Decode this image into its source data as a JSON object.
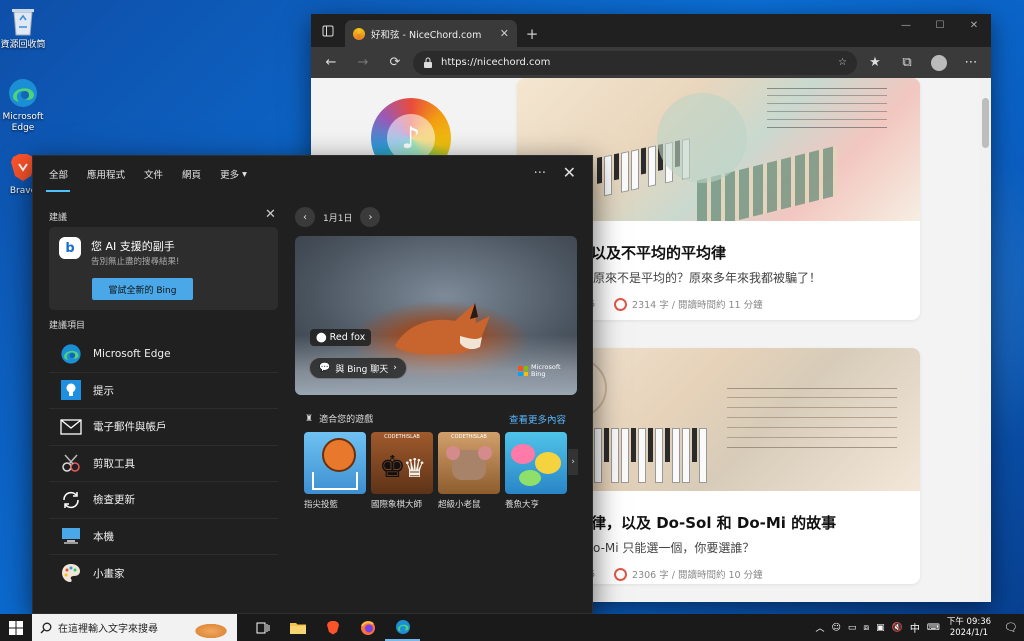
{
  "desktop": {
    "icons": [
      {
        "label": "資源回收筒",
        "icon": "recycle-bin-icon"
      },
      {
        "label": "Microsoft Edge",
        "icon": "edge-icon"
      },
      {
        "label": "Brave",
        "icon": "brave-icon"
      }
    ]
  },
  "browser": {
    "tab_title": "好和弦 - NiceChord.com",
    "url": "https://nicechord.com",
    "cards": [
      {
        "title": "以及不平均的平均律",
        "desc": "原來不是平均的？原來多年來我都被騙了！",
        "meta_left": "6",
        "meta": "2314 字 / 閱讀時間約 11 分鐘"
      },
      {
        "title": "律，以及 Do-Sol 和 Do-Mi 的故事",
        "desc": "o-Mi 只能選一個，你要選誰？",
        "meta_left": "6",
        "meta": "2306 字 / 閱讀時間約 10 分鐘"
      }
    ]
  },
  "search_panel": {
    "tabs": [
      "全部",
      "應用程式",
      "文件",
      "網頁",
      "更多"
    ],
    "suggestions_label": "建議",
    "ai_card": {
      "heading": "您 AI 支援的副手",
      "sub": "告別無止盡的搜尋結果!",
      "button": "嘗試全新的 Bing"
    },
    "suggested_items_label": "建議項目",
    "apps": [
      {
        "label": "Microsoft Edge",
        "icon": "edge-icon"
      },
      {
        "label": "提示",
        "icon": "lightbulb-icon"
      },
      {
        "label": "電子郵件與帳戶",
        "icon": "mail-icon"
      },
      {
        "label": "剪取工具",
        "icon": "scissors-icon"
      },
      {
        "label": "檢查更新",
        "icon": "refresh-icon"
      },
      {
        "label": "本機",
        "icon": "computer-icon"
      },
      {
        "label": "小畫家",
        "icon": "paint-palette-icon"
      }
    ],
    "date": "1月1日",
    "hero": {
      "tag": "Red fox",
      "chat_button": "與 Bing 聊天",
      "brand": "Microsoft Bing"
    },
    "games_label": "適合您的遊戲",
    "see_more": "查看更多內容",
    "games": [
      {
        "name": "指尖投籃"
      },
      {
        "name": "國際象棋大師"
      },
      {
        "name": "超級小老鼠"
      },
      {
        "name": "養魚大亨"
      }
    ],
    "game_thumb_label": "CODETHISLAB"
  },
  "taskbar": {
    "search_placeholder": "在這裡輸入文字來搜尋",
    "ime": "中",
    "time": "下午 09:36",
    "date": "2024/1/1"
  },
  "colors": {
    "accent": "#4cc2ff",
    "bing_button": "#4aa8e8",
    "link": "#5ab7ff"
  }
}
